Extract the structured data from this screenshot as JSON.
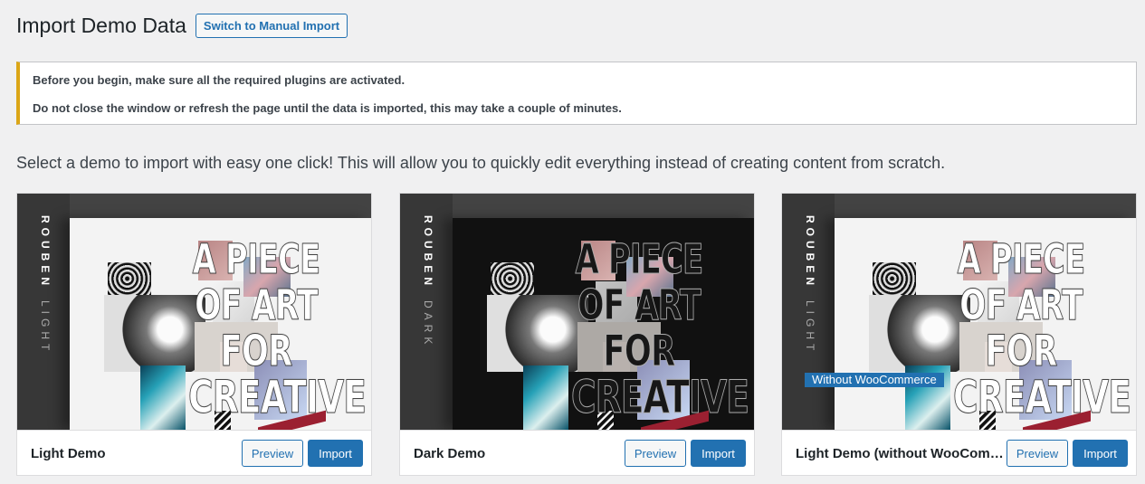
{
  "header": {
    "title": "Import Demo Data",
    "manual_button": "Switch to Manual Import"
  },
  "notice": {
    "line_1": "Before you begin, make sure all the required plugins are activated.",
    "line_2": "Do not close the window or refresh the page until the data is imported, this may take a couple of minutes."
  },
  "intro": "Select a demo to import with easy one click! This will allow you to quickly edit everything instead of creating content from scratch.",
  "demos": [
    {
      "name": "Light Demo",
      "brand": "ROUBEN",
      "variant": "LIGHT",
      "hero_lines": [
        "A PIECE",
        "OF ART",
        "FOR",
        "CREATIVE"
      ],
      "preview_label": "Preview",
      "import_label": "Import"
    },
    {
      "name": "Dark Demo",
      "brand": "ROUBEN",
      "variant": "DARK",
      "hero_lines": [
        "A PIECE",
        "OF ART",
        "FOR",
        "CREATIVE"
      ],
      "preview_label": "Preview",
      "import_label": "Import"
    },
    {
      "name": "Light Demo (without WooComm...",
      "brand": "ROUBEN",
      "variant": "LIGHT",
      "badge": "Without WooCommerce",
      "hero_lines": [
        "A PIECE",
        "OF ART",
        "FOR",
        "CREATIVE"
      ],
      "preview_label": "Preview",
      "import_label": "Import"
    }
  ],
  "colors": {
    "background": "#f0f0f1",
    "accent": "#2271b1",
    "notice_border": "#dba617",
    "dark_rail": "#373737"
  }
}
